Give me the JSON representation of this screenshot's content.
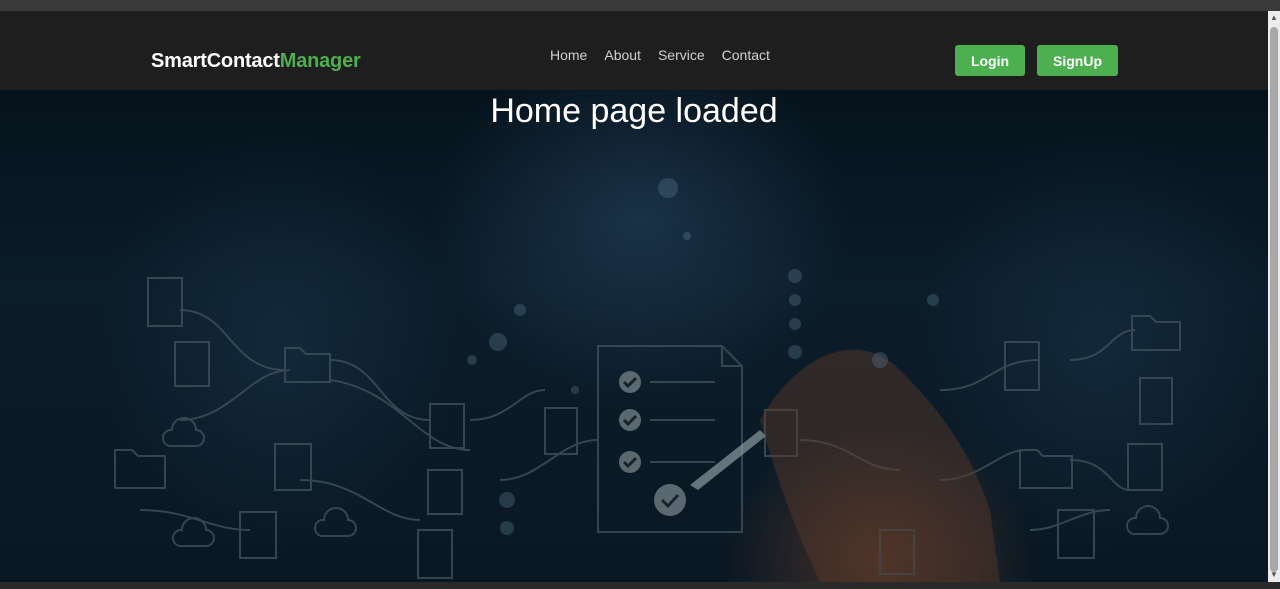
{
  "brand": {
    "part1": "SmartContact",
    "part2": "Manager"
  },
  "nav": [
    {
      "label": "Home"
    },
    {
      "label": "About"
    },
    {
      "label": "Service"
    },
    {
      "label": "Contact"
    }
  ],
  "actions": {
    "login_label": "Login",
    "signup_label": "SignUp"
  },
  "hero": {
    "title": "Home page loaded"
  },
  "colors": {
    "accent": "#4caf50",
    "navbar_bg": "#1e1e1e",
    "hero_bg": "#0b1d29"
  }
}
